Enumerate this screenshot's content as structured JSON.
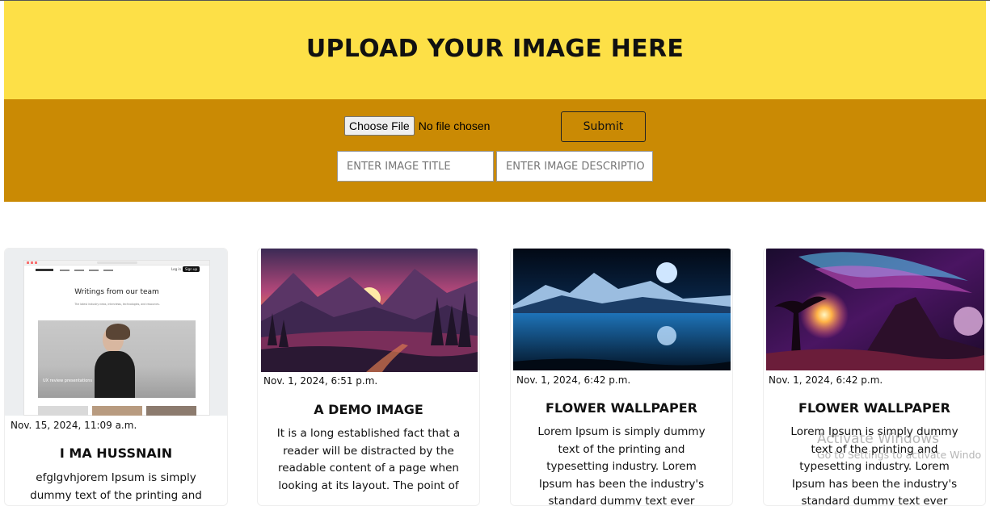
{
  "header": {
    "title": "UPLOAD YOUR IMAGE HERE"
  },
  "upload": {
    "choose_file_label": "Choose File",
    "file_status": "No file chosen",
    "submit_label": "Submit",
    "title_placeholder": "ENTER IMAGE TITLE",
    "description_placeholder": "ENTER IMAGE DESCRIPTIO"
  },
  "cards": [
    {
      "date": "Nov. 15, 2024, 11:09 a.m.",
      "title": "I MA HUSSNAIN",
      "description": "efglgvhjorem Ipsum is simply dummy text of the printing and typesetting",
      "thumb": {
        "heading": "Writings from our team",
        "subheading": "The latest industry news, interviews, technologies, and resources.",
        "feature_label": "UX review presentations",
        "login": "Log in",
        "signup": "Sign up"
      }
    },
    {
      "date": "Nov. 1, 2024, 6:51 p.m.",
      "title": "A DEMO IMAGE",
      "description": "It is a long established fact that a reader will be distracted by the readable content of a page when looking at its layout. The point of"
    },
    {
      "date": "Nov. 1, 2024, 6:42 p.m.",
      "title": "FLOWER WALLPAPER",
      "description": "Lorem Ipsum is simply dummy text of the printing and typesetting industry. Lorem Ipsum has been the industry's standard dummy text ever"
    },
    {
      "date": "Nov. 1, 2024, 6:42 p.m.",
      "title": "FLOWER WALLPAPER",
      "description": "Lorem Ipsum is simply dummy text of the printing and typesetting industry. Lorem Ipsum has been the industry's standard dummy text ever"
    }
  ],
  "watermark": {
    "line1": "Activate Windows",
    "line2": "Go to Settings to activate Windo"
  },
  "colors": {
    "header_bg": "#fde047",
    "upload_bg": "#ca8a04"
  }
}
